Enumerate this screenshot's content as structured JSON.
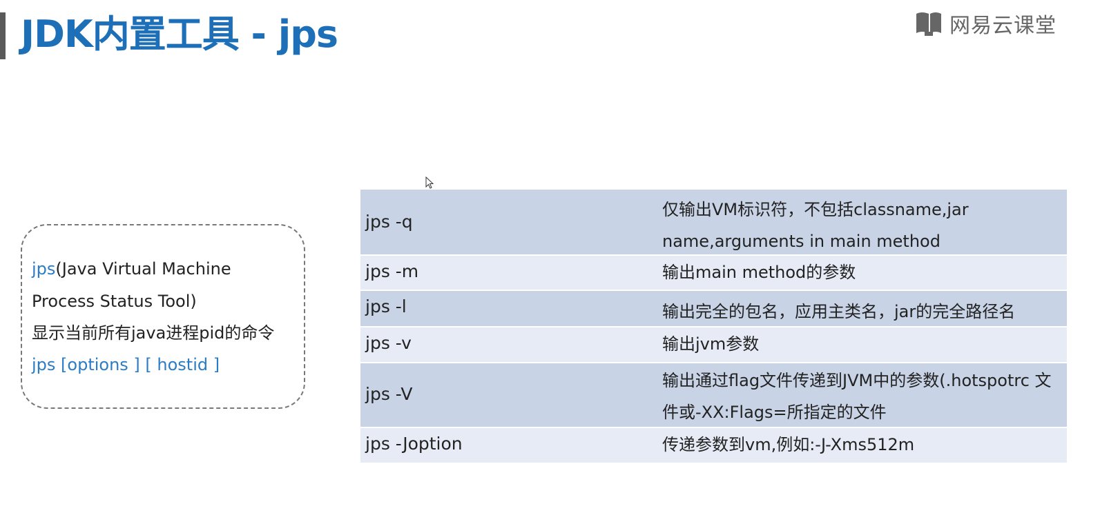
{
  "header": {
    "title": "JDK内置工具 - jps",
    "brand": "网易云课堂",
    "brand_icon": "book-icon"
  },
  "info_box": {
    "line1_blue": "jps",
    "line1_rest": "(Java Virtual Machine",
    "line2": "Process Status Tool)",
    "line3": "显示当前所有java进程pid的命令",
    "line4": "jps [options ] [ hostid ]"
  },
  "options_table": {
    "rows": [
      {
        "command": "jps  -q",
        "description": "仅输出VM标识符，不包括classname,jar name,arguments in main method"
      },
      {
        "command": "jps  -m",
        "description": "输出main method的参数"
      },
      {
        "command": "jps -l",
        "description": "输出完全的包名，应用主类名，jar的完全路径名"
      },
      {
        "command": "jps  -v",
        "description": "输出jvm参数"
      },
      {
        "command": "jps  -V",
        "description": "输出通过flag文件传递到JVM中的参数(.hotspotrc 文件或-XX:Flags=所指定的文件"
      },
      {
        "command": "jps  -Joption",
        "description": "传递参数到vm,例如:-J-Xms512m"
      }
    ]
  },
  "colors": {
    "title": "#1d6fb8",
    "link_blue": "#2b7cc4",
    "row_dark": "#c8d3e6",
    "row_light": "#e6ebf5"
  }
}
